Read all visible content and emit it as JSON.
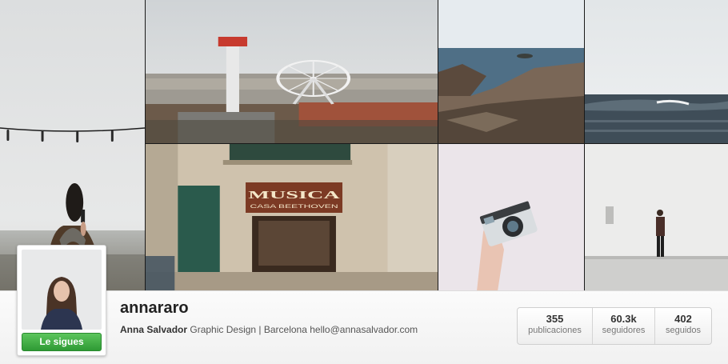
{
  "profile": {
    "username": "annararo",
    "full_name": "Anna Salvador",
    "bio_text": "Graphic Design | Barcelona hello@annasalvador.com",
    "follow_button_label": "Le sigues"
  },
  "stats": [
    {
      "value": "355",
      "label": "publicaciones"
    },
    {
      "value": "60.3k",
      "label": "seguidores"
    },
    {
      "value": "402",
      "label": "seguidos"
    }
  ],
  "photo_grid": {
    "tile_count": 7,
    "shop_sign_text": "MUSICA",
    "shop_sign_subtext": "CASA BEETHOVEN"
  },
  "colors": {
    "follow_button": "#3aa83e",
    "page_background": "#ffffff",
    "grid_gap": "#1a1a1a"
  }
}
